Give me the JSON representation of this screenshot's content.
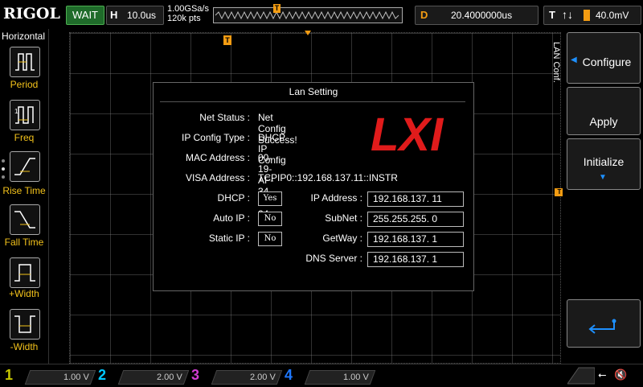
{
  "header": {
    "logo": "RIGOL",
    "run_status": "WAIT",
    "timebase_label": "H",
    "timebase_value": "10.0us",
    "sample_rate": "1.00GSa/s",
    "memory_depth": "120k pts",
    "trigger_marker": "T",
    "delay_label": "D",
    "delay_value": "20.4000000us",
    "trigger_label": "T",
    "trigger_level": "40.0mV"
  },
  "left_menu": {
    "title": "Horizontal",
    "items": [
      {
        "label": "Period",
        "icon": "period-icon"
      },
      {
        "label": "Freq",
        "icon": "frequency-icon"
      },
      {
        "label": "Rise Time",
        "icon": "rise-time-icon"
      },
      {
        "label": "Fall Time",
        "icon": "fall-time-icon"
      },
      {
        "label": "+Width",
        "icon": "positive-width-icon"
      },
      {
        "label": "-Width",
        "icon": "negative-width-icon"
      }
    ]
  },
  "dialog": {
    "title": "Lan Setting",
    "net_status_label": "Net Status :",
    "net_status_value": "Net Config Success!",
    "ip_config_type_label": "IP Config Type :",
    "ip_config_type_value": "DHCP IP Config",
    "mac_label": "MAC Address :",
    "mac_value": "00-19-AF-34-F0-24",
    "visa_label": "VISA Address :",
    "visa_value": "TCPIP0::192.168.137.11::INSTR",
    "dhcp_label": "DHCP :",
    "dhcp_value": "Yes",
    "auto_ip_label": "Auto IP :",
    "auto_ip_value": "No",
    "static_ip_label": "Static IP :",
    "static_ip_value": "No",
    "ip_address_label": "IP Address :",
    "ip_address_value": "192.168.137. 11",
    "subnet_label": "SubNet :",
    "subnet_value": "255.255.255. 0",
    "gateway_label": "GetWay :",
    "gateway_value": "192.168.137. 1",
    "dns_label": "DNS Server :",
    "dns_value": "192.168.137. 1",
    "logo": "LXI"
  },
  "right_menu": {
    "title": "LAN Conf.",
    "configure": "Configure",
    "apply": "Apply",
    "initialize": "Initialize"
  },
  "channels": [
    {
      "num": "1",
      "volts": "1.00 V",
      "color": "#c8c800"
    },
    {
      "num": "2",
      "volts": "2.00 V",
      "color": "#00c8ff"
    },
    {
      "num": "3",
      "volts": "2.00 V",
      "color": "#d23cd2"
    },
    {
      "num": "4",
      "volts": "1.00 V",
      "color": "#1e78ff"
    }
  ],
  "colors": {
    "accent": "#f39c12",
    "menu_label": "#f3c21b",
    "lxi_red": "#e01b1b",
    "wait_green": "#1f6b2a"
  }
}
